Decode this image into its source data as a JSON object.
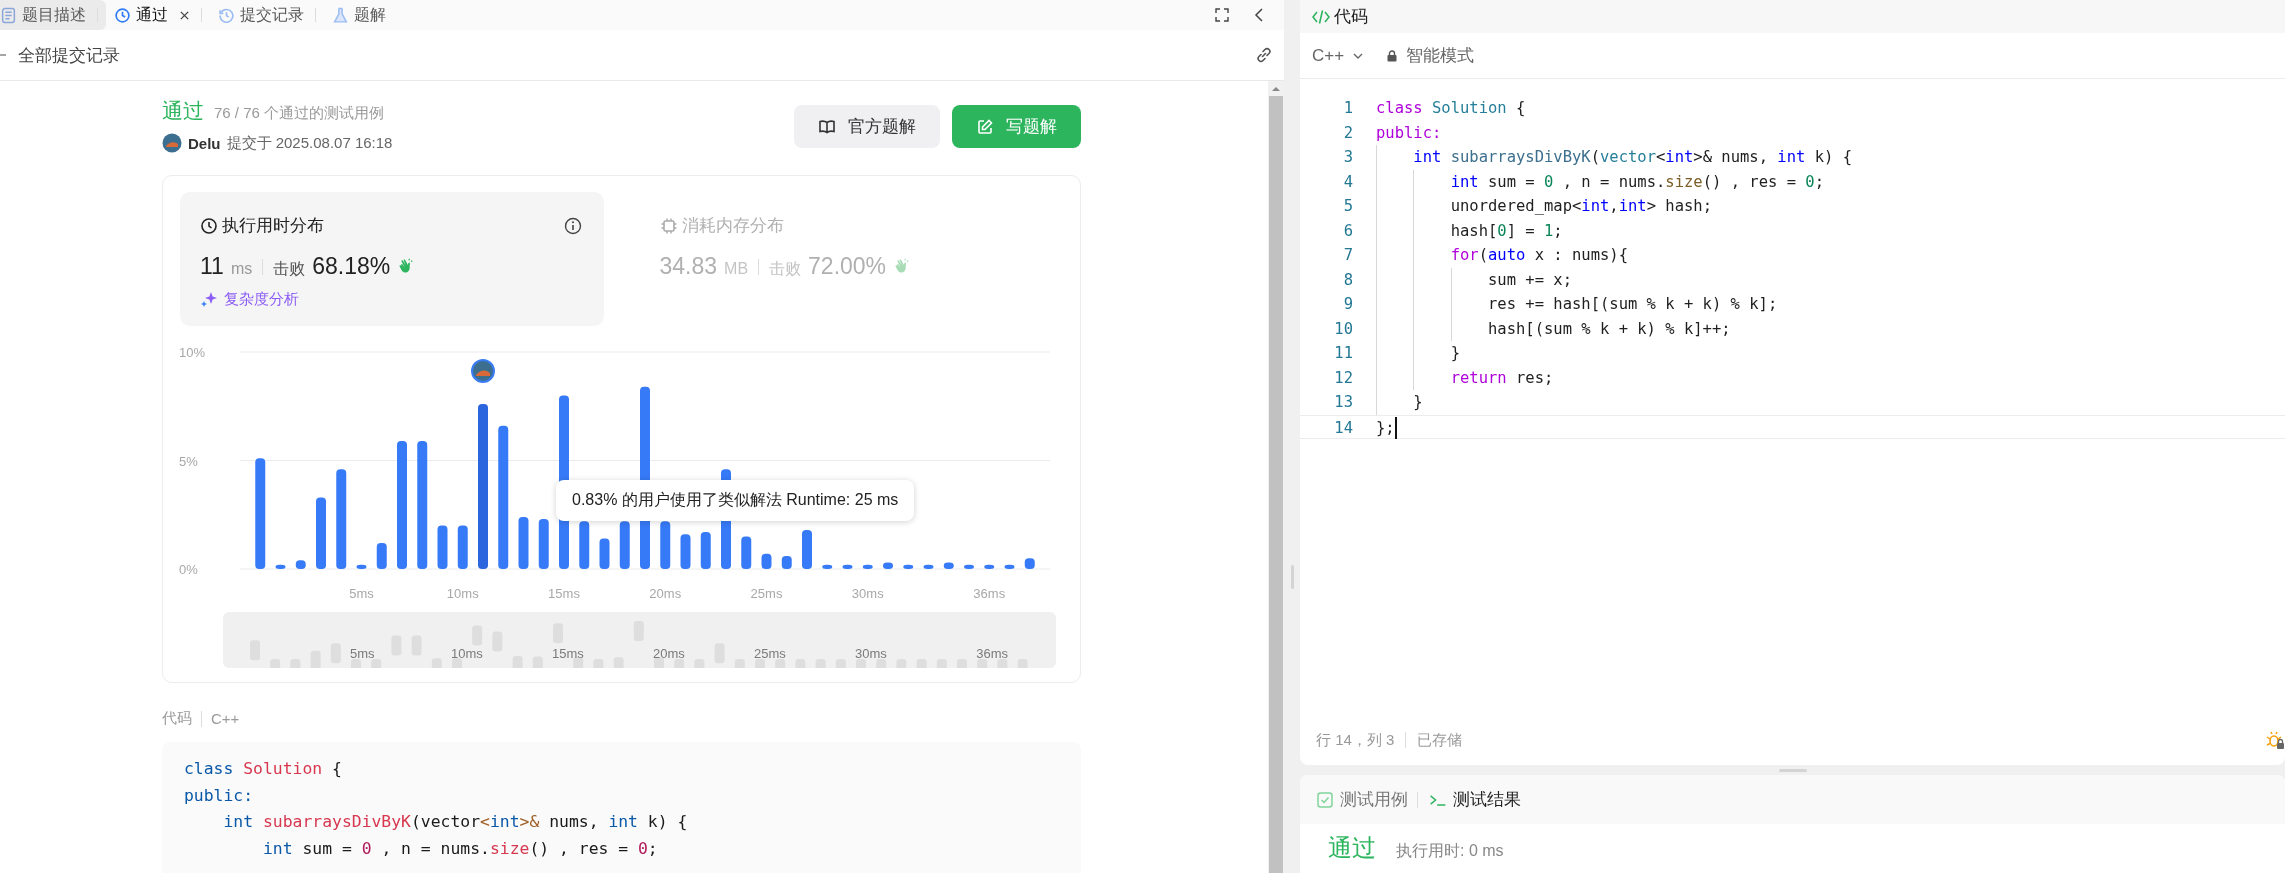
{
  "tabs": [
    {
      "label": "题目描述",
      "selected": false,
      "hovered": true,
      "closable": false
    },
    {
      "label": "通过",
      "selected": true,
      "hovered": false,
      "closable": true
    },
    {
      "label": "提交记录",
      "selected": false,
      "hovered": false,
      "closable": false
    },
    {
      "label": "题解",
      "selected": false,
      "hovered": false,
      "closable": false
    }
  ],
  "back_link": {
    "label": "全部提交记录"
  },
  "submission": {
    "status": "通过",
    "cases": "76 / 76 个通过的测试用例",
    "user": "Delu",
    "submitted": "提交于 2025.08.07 16:18"
  },
  "buttons": [
    {
      "label": "官方题解",
      "kind": "secondary"
    },
    {
      "label": "写题解",
      "kind": "primary"
    }
  ],
  "stats": [
    {
      "kind": "runtime",
      "selected": true,
      "title": "执行用时分布",
      "value": "11",
      "unit": "ms",
      "beat_label": "击败",
      "beat_value": "68.18%",
      "link": "复杂度分析"
    },
    {
      "kind": "memory",
      "selected": false,
      "title": "消耗内存分布",
      "value": "34.83",
      "unit": "MB",
      "beat_label": "击败",
      "beat_value": "72.00%"
    }
  ],
  "chart_data": {
    "type": "bar",
    "x": [
      0,
      1,
      2,
      3,
      4,
      5,
      6,
      7,
      8,
      9,
      10,
      11,
      12,
      13,
      14,
      15,
      16,
      17,
      18,
      19,
      20,
      21,
      22,
      23,
      24,
      25,
      26,
      27,
      28,
      29,
      30,
      31,
      32,
      33,
      34,
      35,
      36,
      37,
      38
    ],
    "values": [
      5.1,
      0.2,
      0.4,
      3.3,
      4.6,
      0.2,
      1.2,
      5.9,
      5.9,
      2.0,
      2.0,
      7.6,
      6.6,
      2.4,
      2.3,
      8.0,
      2.2,
      1.4,
      2.2,
      8.4,
      2.2,
      1.6,
      1.7,
      4.6,
      1.5,
      0.7,
      0.6,
      1.8,
      0.2,
      0.2,
      0.2,
      0.3,
      0.2,
      0.2,
      0.3,
      0.2,
      0.2,
      0.2,
      0.5
    ],
    "xlim": [
      -1,
      39
    ],
    "ylim": [
      0,
      10
    ],
    "yticks": [
      {
        "value": 0,
        "label": "0%"
      },
      {
        "value": 5,
        "label": "5%"
      },
      {
        "value": 10,
        "label": "10%"
      }
    ],
    "xticks": [
      {
        "value": 5,
        "label": "5ms"
      },
      {
        "value": 10,
        "label": "10ms"
      },
      {
        "value": 15,
        "label": "15ms"
      },
      {
        "value": 20,
        "label": "20ms"
      },
      {
        "value": 25,
        "label": "25ms"
      },
      {
        "value": 30,
        "label": "30ms"
      },
      {
        "value": 36,
        "label": "36ms"
      }
    ]
  },
  "tooltip": "0.83% 的用户使用了类似解法 Runtime: 25 ms",
  "brush_labels": [
    "5ms",
    "10ms",
    "15ms",
    "20ms",
    "25ms",
    "30ms",
    "36ms"
  ],
  "code_section": {
    "label": "代码",
    "language": "C++",
    "lines": [
      [
        {
          "kind": "kw",
          "text": "class "
        },
        {
          "kind": "cls",
          "text": "Solution "
        },
        {
          "kind": "p",
          "text": "{"
        }
      ],
      [
        {
          "kind": "kw",
          "text": "public:"
        }
      ],
      [
        {
          "kind": "ty",
          "text": "    int "
        },
        {
          "kind": "fn",
          "text": "subarraysDivByK"
        },
        {
          "kind": "p",
          "text": "(vector"
        },
        {
          "kind": "op",
          "text": "<"
        },
        {
          "kind": "ty",
          "text": "int"
        },
        {
          "kind": "op",
          "text": ">&"
        },
        {
          "kind": "p",
          "text": " nums, "
        },
        {
          "kind": "ty",
          "text": "int"
        },
        {
          "kind": "p",
          "text": " k) {"
        }
      ],
      [
        {
          "kind": "ty",
          "text": "        int"
        },
        {
          "kind": "p",
          "text": " sum = "
        },
        {
          "kind": "num",
          "text": "0"
        },
        {
          "kind": "p",
          "text": " , n = nums."
        },
        {
          "kind": "m",
          "text": "size"
        },
        {
          "kind": "p",
          "text": "() , res = "
        },
        {
          "kind": "num",
          "text": "0"
        },
        {
          "kind": "p",
          "text": ";"
        }
      ]
    ]
  },
  "editor": {
    "title": "代码",
    "language": "C++",
    "mode": "智能模式",
    "lines": [
      {
        "no": "1",
        "tokens": [
          {
            "kind": "kw",
            "text": "class "
          },
          {
            "kind": "cls",
            "text": "Solution"
          },
          {
            "kind": "p",
            "text": " {"
          }
        ]
      },
      {
        "no": "2",
        "tokens": [
          {
            "kind": "kw",
            "text": "public:"
          }
        ]
      },
      {
        "no": "3",
        "tokens": [
          {
            "kind": "ty",
            "text": "    int "
          },
          {
            "kind": "fn",
            "text": "subarraysDivByK"
          },
          {
            "kind": "p",
            "text": "("
          },
          {
            "kind": "cls",
            "text": "vector"
          },
          {
            "kind": "p",
            "text": "<"
          },
          {
            "kind": "ty",
            "text": "int"
          },
          {
            "kind": "p",
            "text": ">& nums, "
          },
          {
            "kind": "ty",
            "text": "int"
          },
          {
            "kind": "p",
            "text": " k) {"
          }
        ]
      },
      {
        "no": "4",
        "tokens": [
          {
            "kind": "ty",
            "text": "        int"
          },
          {
            "kind": "p",
            "text": " sum = "
          },
          {
            "kind": "num",
            "text": "0"
          },
          {
            "kind": "p",
            "text": " , n = nums."
          },
          {
            "kind": "m",
            "text": "size"
          },
          {
            "kind": "p",
            "text": "() , res = "
          },
          {
            "kind": "num",
            "text": "0"
          },
          {
            "kind": "p",
            "text": ";"
          }
        ]
      },
      {
        "no": "5",
        "tokens": [
          {
            "kind": "p",
            "text": "        unordered_map<"
          },
          {
            "kind": "ty",
            "text": "int"
          },
          {
            "kind": "p",
            "text": ","
          },
          {
            "kind": "ty",
            "text": "int"
          },
          {
            "kind": "p",
            "text": "> hash;"
          }
        ]
      },
      {
        "no": "6",
        "tokens": [
          {
            "kind": "p",
            "text": "        hash["
          },
          {
            "kind": "num",
            "text": "0"
          },
          {
            "kind": "p",
            "text": "] = "
          },
          {
            "kind": "num",
            "text": "1"
          },
          {
            "kind": "p",
            "text": ";"
          }
        ]
      },
      {
        "no": "7",
        "tokens": [
          {
            "kind": "kw",
            "text": "        for"
          },
          {
            "kind": "p",
            "text": "("
          },
          {
            "kind": "ty",
            "text": "auto"
          },
          {
            "kind": "p",
            "text": " x : nums){"
          }
        ]
      },
      {
        "no": "8",
        "tokens": [
          {
            "kind": "p",
            "text": "            sum += x;"
          }
        ]
      },
      {
        "no": "9",
        "tokens": [
          {
            "kind": "p",
            "text": "            res += hash[(sum % k + k) % k];"
          }
        ]
      },
      {
        "no": "10",
        "tokens": [
          {
            "kind": "p",
            "text": "            hash[(sum % k + k) % k]++;"
          }
        ]
      },
      {
        "no": "11",
        "tokens": [
          {
            "kind": "p",
            "text": "        }"
          }
        ]
      },
      {
        "no": "12",
        "tokens": [
          {
            "kind": "kw",
            "text": "        return"
          },
          {
            "kind": "p",
            "text": " res;"
          }
        ]
      },
      {
        "no": "13",
        "tokens": [
          {
            "kind": "p",
            "text": "    }"
          }
        ]
      },
      {
        "no": "14",
        "tokens": [
          {
            "kind": "p",
            "text": "};"
          }
        ]
      }
    ],
    "status": "行 14，列 3",
    "saved": "已存储"
  },
  "result_panel": {
    "tabs": [
      {
        "label": "测试用例",
        "selected": false
      },
      {
        "label": "测试结果",
        "selected": true
      }
    ],
    "status": "通过",
    "runtime": "执行用时: 0 ms"
  }
}
